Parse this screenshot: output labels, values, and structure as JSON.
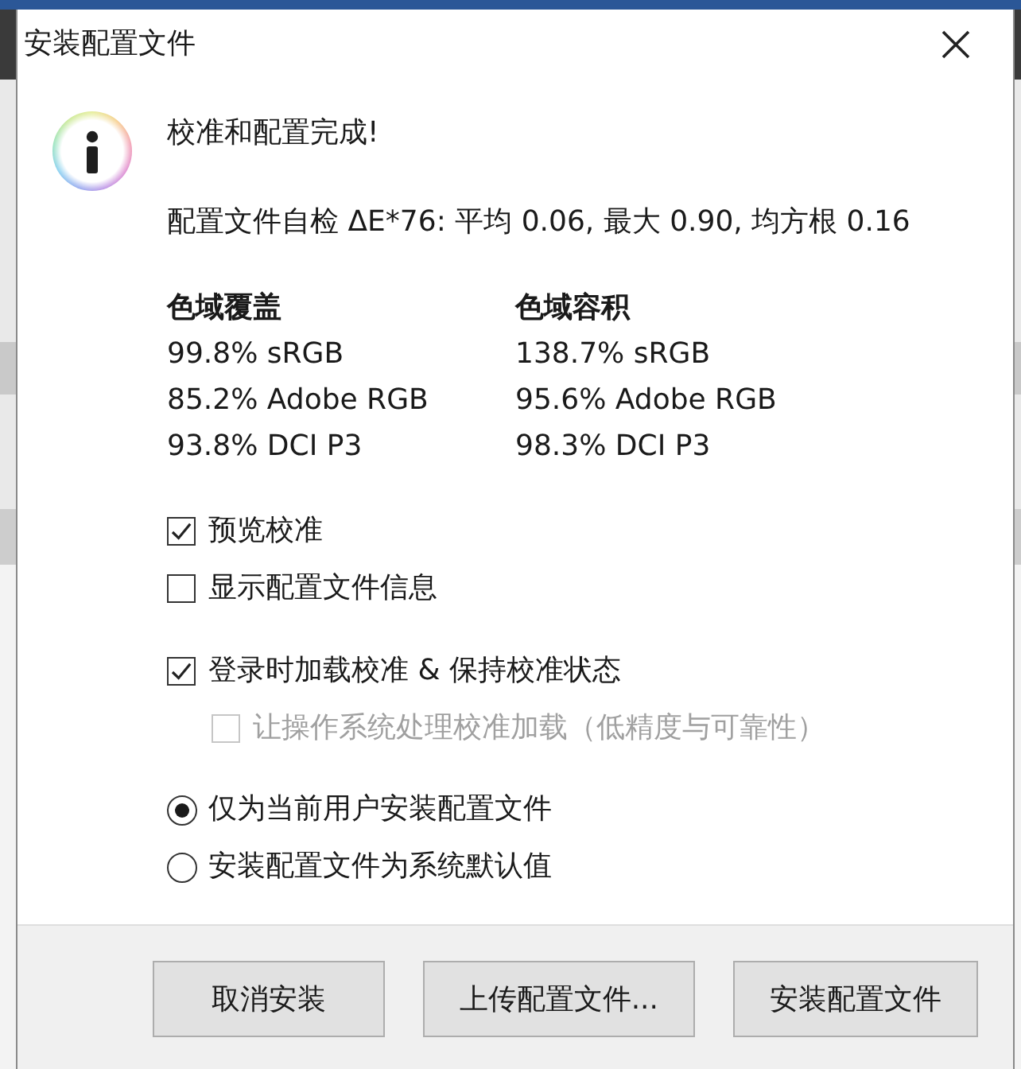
{
  "window": {
    "title": "安装配置文件"
  },
  "message": {
    "heading": "校准和配置完成!",
    "self_check": "配置文件自检 ΔE*76: 平均 0.06, 最大 0.90, 均方根 0.16"
  },
  "gamut": [
    {
      "heading": "色域覆盖",
      "values": [
        "99.8% sRGB",
        "85.2% Adobe RGB",
        "93.8% DCI P3"
      ]
    },
    {
      "heading": "色域容积",
      "values": [
        "138.7% sRGB",
        "95.6% Adobe RGB",
        "98.3% DCI P3"
      ]
    }
  ],
  "checkbox_groups": [
    {
      "items": [
        {
          "label": "预览校准",
          "checked": true,
          "disabled": false
        },
        {
          "label": "显示配置文件信息",
          "checked": false,
          "disabled": false
        }
      ]
    },
    {
      "items": [
        {
          "label": "登录时加载校准 & 保持校准状态",
          "checked": true,
          "disabled": false,
          "children": [
            {
              "label": "让操作系统处理校准加载（低精度与可靠性）",
              "checked": false,
              "disabled": true
            }
          ]
        }
      ]
    }
  ],
  "install_scope": [
    {
      "label": "仅为当前用户安装配置文件",
      "selected": true
    },
    {
      "label": "安装配置文件为系统默认值",
      "selected": false
    }
  ],
  "buttons": [
    "取消安装",
    "上传配置文件...",
    "安装配置文件"
  ]
}
